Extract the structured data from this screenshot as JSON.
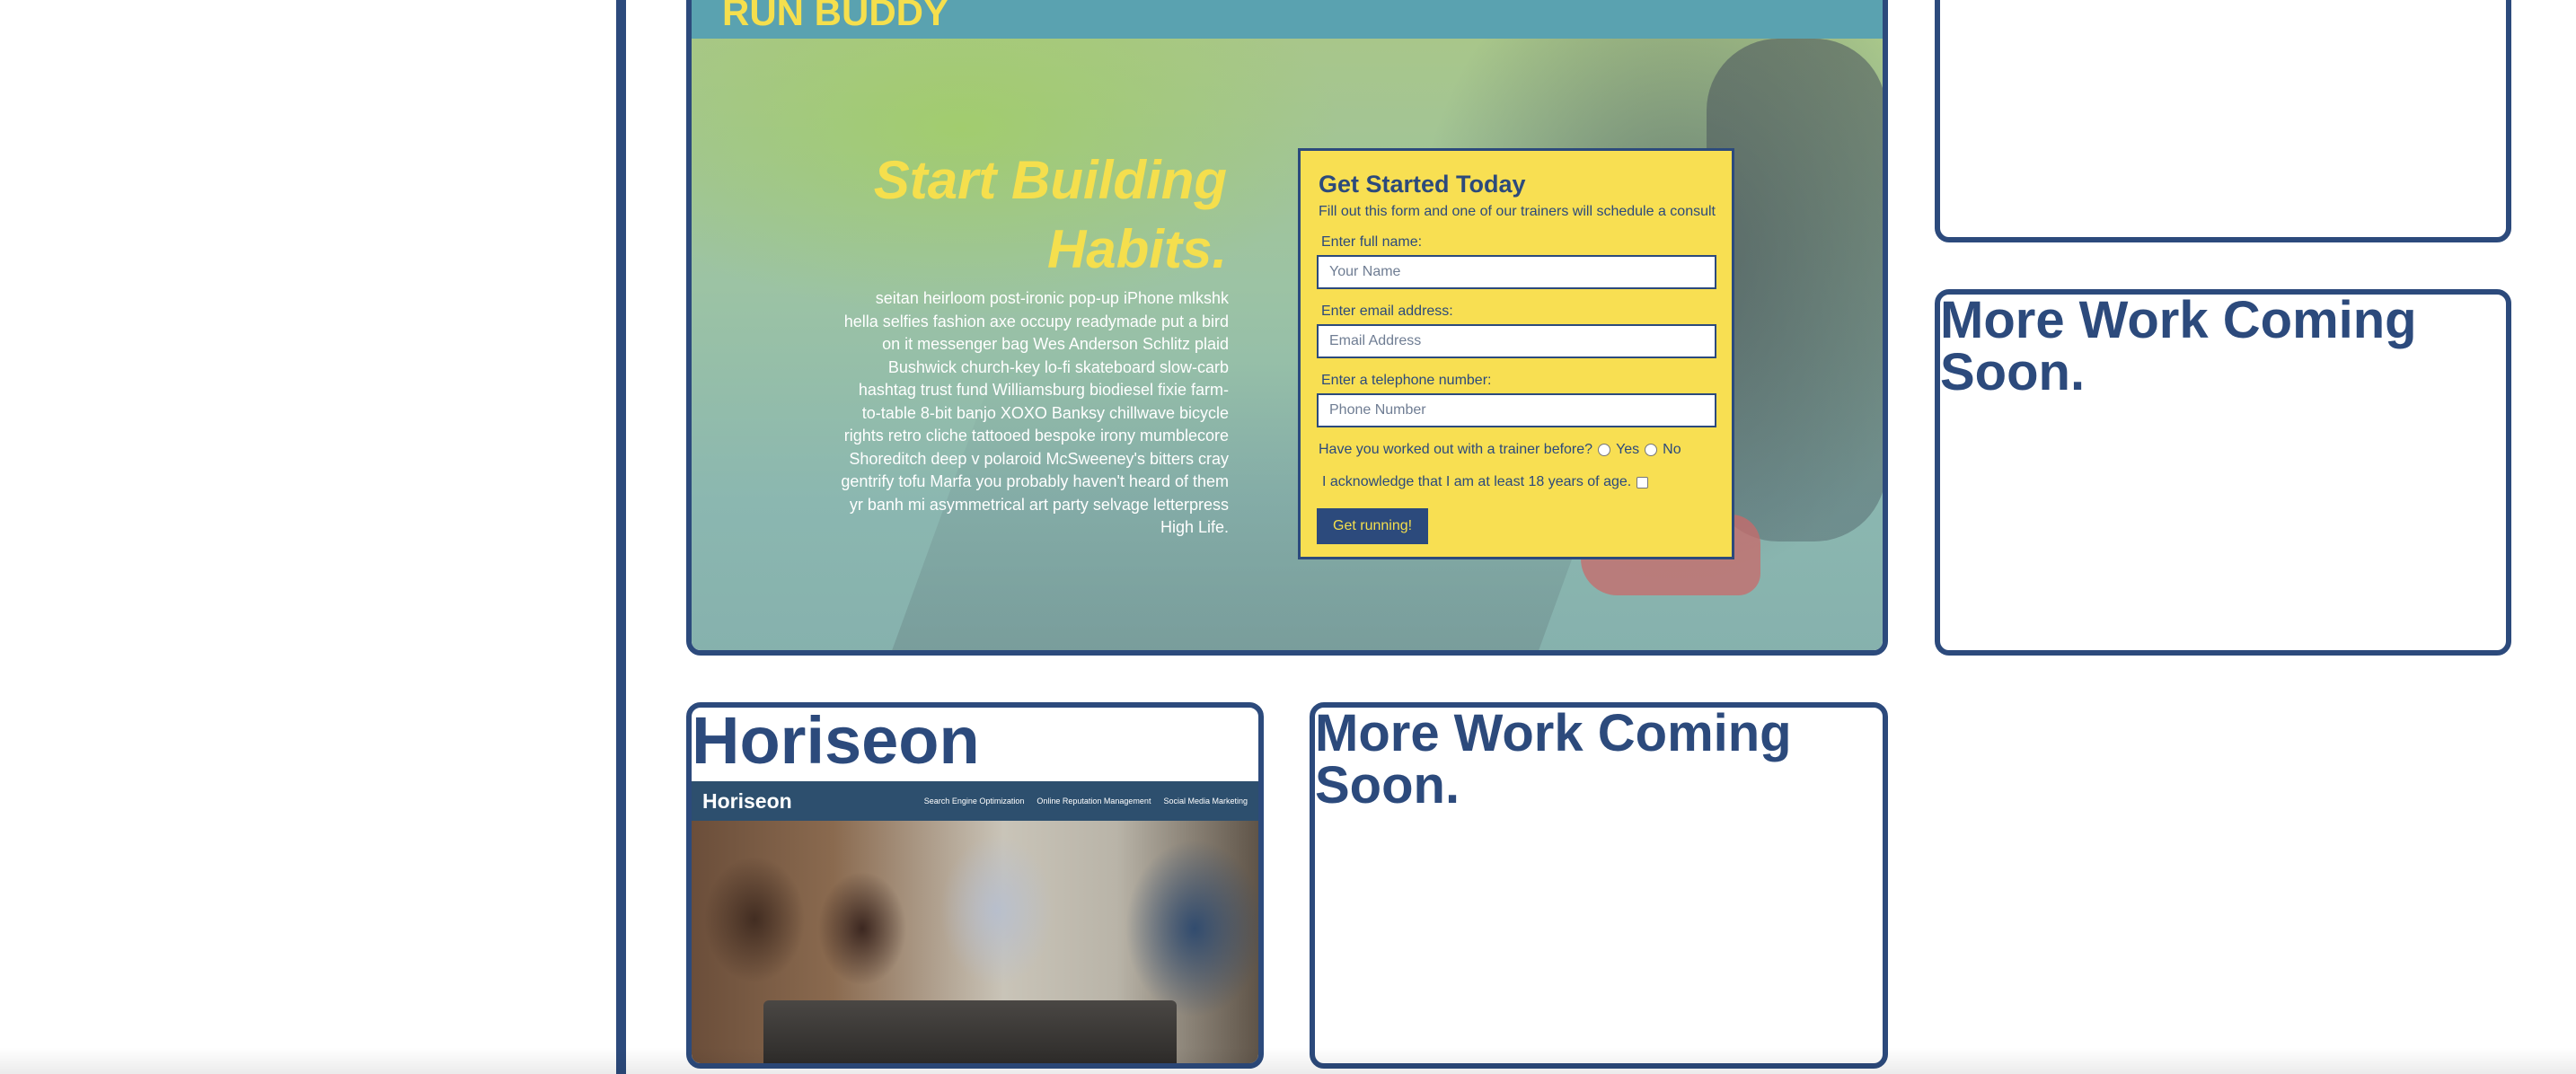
{
  "run_buddy": {
    "logo": "RUN BUDDY",
    "headline": "Start Building Habits.",
    "body": "seitan heirloom post-ironic pop-up iPhone mlkshk hella selfies fashion axe occupy readymade put a bird on it messenger bag Wes Anderson Schlitz plaid Bushwick church-key lo-fi skateboard slow-carb hashtag trust fund Williamsburg biodiesel fixie farm-to-table 8-bit banjo XOXO Banksy chillwave bicycle rights retro cliche tattooed bespoke irony mumblecore Shoreditch deep v polaroid McSweeney's bitters cray gentrify tofu Marfa you probably haven't heard of them yr banh mi asymmetrical art party selvage letterpress High Life.",
    "form": {
      "title": "Get Started Today",
      "subtitle": "Fill out this form and one of our trainers will schedule a consult",
      "name_label": "Enter full name:",
      "name_placeholder": "Your Name",
      "email_label": "Enter email address:",
      "email_placeholder": "Email Address",
      "phone_label": "Enter a telephone number:",
      "phone_placeholder": "Phone Number",
      "trainer_question": "Have you worked out with a trainer before?",
      "yes_label": "Yes",
      "no_label": "No",
      "age_label": "I acknowledge that I am at least 18 years of age.",
      "submit_label": "Get running!"
    }
  },
  "cards": {
    "top_right_title": "",
    "right_title": "More Work Coming Soon.",
    "horiseon_title": "Horiseon",
    "middle_title": "More Work Coming Soon."
  },
  "horiseon_thumb": {
    "logo": "Horiseon",
    "nav": [
      "Search Engine Optimization",
      "Online Reputation Management",
      "Social Media Marketing"
    ]
  },
  "colors": {
    "accent": "#2c4a7c",
    "yellow": "#f5df4d",
    "teal": "#5aa2b0"
  }
}
